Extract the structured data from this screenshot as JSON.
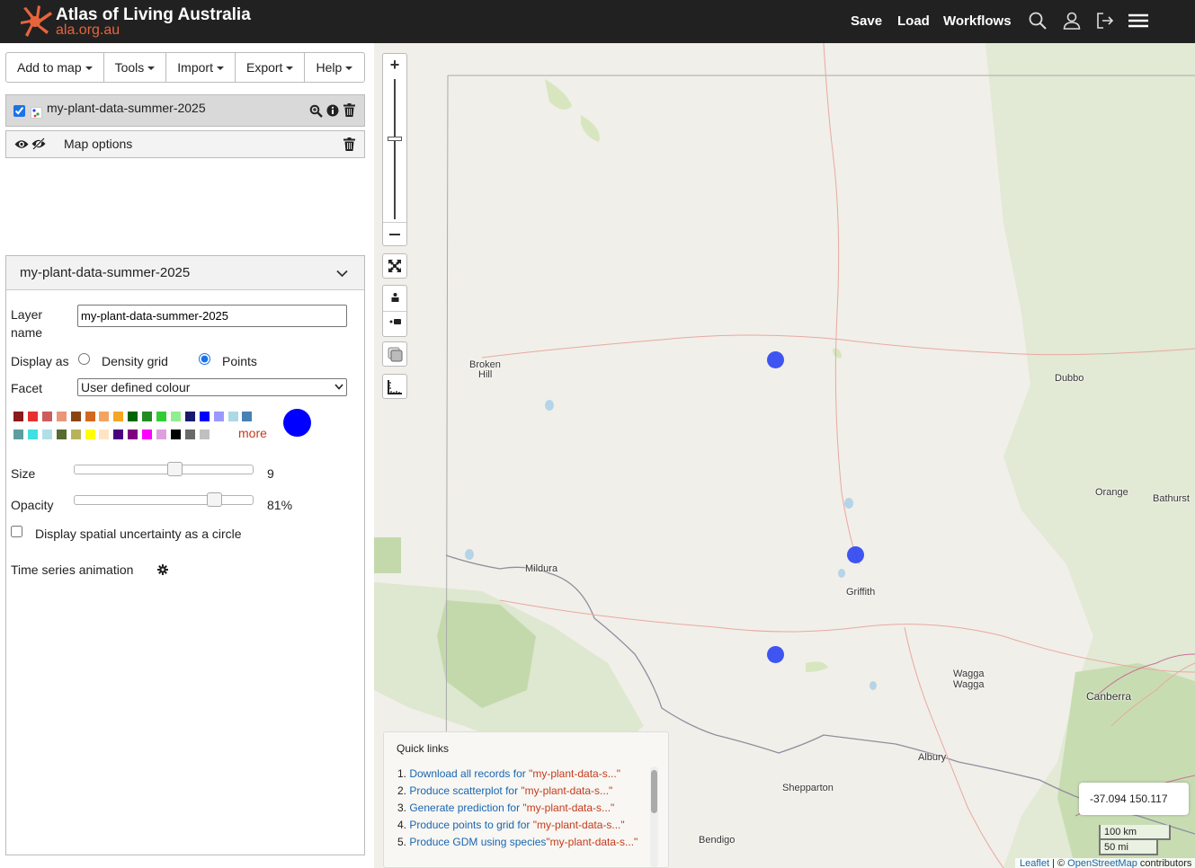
{
  "header": {
    "logo_title": "Atlas of Living Australia",
    "logo_sub": "ala.org.au",
    "nav": [
      "Save",
      "Load",
      "Workflows"
    ],
    "brand_color": "#e8643c"
  },
  "menu": {
    "items": [
      "Add to map",
      "Tools",
      "Import",
      "Export",
      "Help"
    ]
  },
  "layer": {
    "name": "my-plant-data-summer-2025",
    "checked": true
  },
  "map_options": {
    "label": "Map options"
  },
  "panel": {
    "title": "my-plant-data-summer-2025",
    "layer_name_label": "Layer name",
    "layer_name_value": "my-plant-data-summer-2025",
    "display_as_label": "Display as",
    "display_options": [
      "Density grid",
      "Points"
    ],
    "display_selected": "Points",
    "facet_label": "Facet",
    "facet_value": "User defined colour",
    "palette": [
      "#8b1a1a",
      "#e83030",
      "#cd5c5c",
      "#e9967a",
      "#8b4513",
      "#d2691e",
      "#f4a460",
      "#f5a623",
      "#006400",
      "#228b22",
      "#32cd32",
      "#90ee90",
      "#191970",
      "#0000ff",
      "#9999ff",
      "#add8e6",
      "#4682b4",
      "#5f9ea0",
      "#40e0e0",
      "#b0e0e6",
      "#556b2f",
      "#b8b35a",
      "#ffff00",
      "#ffe4c4",
      "#4b0082",
      "#800080",
      "#ff00ff",
      "#dda0dd",
      "#000000",
      "#696969",
      "#c0c0c0"
    ],
    "more_label": "more",
    "selected_color": "#0000ff",
    "size_label": "Size",
    "size_value": "9",
    "size_fraction": 0.57,
    "opacity_label": "Opacity",
    "opacity_value": "81%",
    "opacity_fraction": 0.81,
    "uncertainty_label": "Display spatial uncertainty as a circle",
    "time_series_label": "Time series animation"
  },
  "map": {
    "zoom_fraction": 0.42,
    "towns": [
      "Broken",
      "Hill",
      "Mildura",
      "Griffith",
      "Dubbo",
      "Orange",
      "Bathurst",
      "Wagga",
      "Wagga",
      "Canberra",
      "Albury",
      "Shepparton",
      "Bendigo"
    ],
    "quick_links": {
      "title": "Quick links",
      "items": [
        {
          "num": "1.",
          "text": "Download all records for ",
          "q": "\"my-plant-data-s...\""
        },
        {
          "num": "2.",
          "text": "Produce scatterplot for ",
          "q": "\"my-plant-data-s...\""
        },
        {
          "num": "3.",
          "text": "Generate prediction for ",
          "q": "\"my-plant-data-s...\""
        },
        {
          "num": "4.",
          "text": "Produce points to grid for ",
          "q": "\"my-plant-data-s...\""
        },
        {
          "num": "5.",
          "text": "Produce GDM using species",
          "q": "\"my-plant-data-s...\""
        }
      ]
    },
    "coords": "-37.094   150.117",
    "scale_km": "100 km",
    "scale_mi": "50 mi",
    "attribution_leaflet": "Leaflet",
    "attribution_sep": " | © ",
    "attribution_osm": "OpenStreetMap",
    "attribution_tail": " contributors"
  }
}
